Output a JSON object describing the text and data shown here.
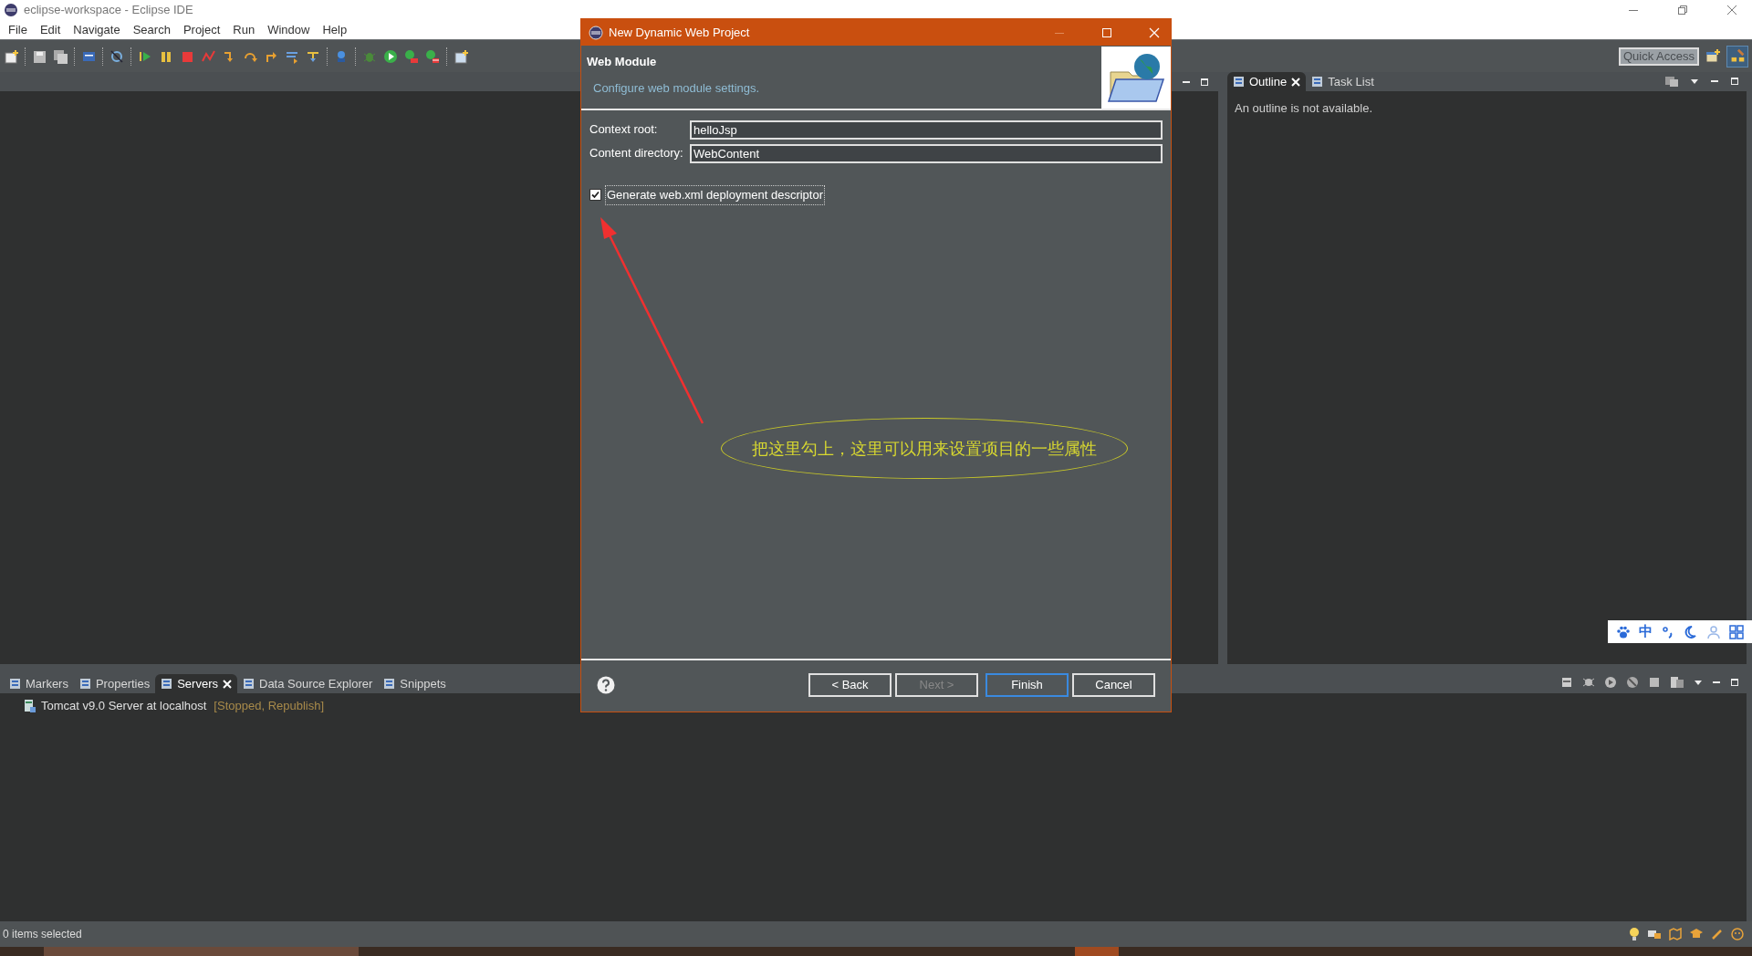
{
  "window": {
    "title": "eclipse-workspace - Eclipse IDE"
  },
  "menu": [
    "File",
    "Edit",
    "Navigate",
    "Search",
    "Project",
    "Run",
    "Window",
    "Help"
  ],
  "quick_access": {
    "placeholder": "Quick Access"
  },
  "outline_panel": {
    "tabs": [
      {
        "label": "Outline",
        "selected": true,
        "closable": true
      },
      {
        "label": "Task List",
        "selected": false,
        "closable": false
      }
    ],
    "message": "An outline is not available."
  },
  "bottom_panel": {
    "tabs": [
      {
        "label": "Markers",
        "selected": false,
        "closable": false
      },
      {
        "label": "Properties",
        "selected": false,
        "closable": false
      },
      {
        "label": "Servers",
        "selected": true,
        "closable": true
      },
      {
        "label": "Data Source Explorer",
        "selected": false,
        "closable": false
      },
      {
        "label": "Snippets",
        "selected": false,
        "closable": false
      }
    ],
    "servers": [
      {
        "name": "Tomcat v9.0 Server at localhost",
        "state": "[Stopped, Republish]"
      }
    ]
  },
  "status_bar": {
    "text": "0 items selected"
  },
  "dialog": {
    "title": "New Dynamic Web Project",
    "heading": "Web Module",
    "description": "Configure web module settings.",
    "fields": [
      {
        "label": "Context root:",
        "value": "helloJsp"
      },
      {
        "label": "Content directory:",
        "value": "WebContent"
      }
    ],
    "checkbox": {
      "label": "Generate web.xml deployment descriptor",
      "checked": true
    },
    "buttons": [
      {
        "label": "< Back",
        "disabled": false,
        "default": false
      },
      {
        "label": "Next >",
        "disabled": true,
        "default": false
      },
      {
        "label": "Finish",
        "disabled": false,
        "default": true
      },
      {
        "label": "Cancel",
        "disabled": false,
        "default": false
      }
    ]
  },
  "annotation": {
    "text": "把这里勾上，这里可以用来设置项目的一些属性"
  },
  "ime_toolbar": {
    "mode": "中"
  }
}
